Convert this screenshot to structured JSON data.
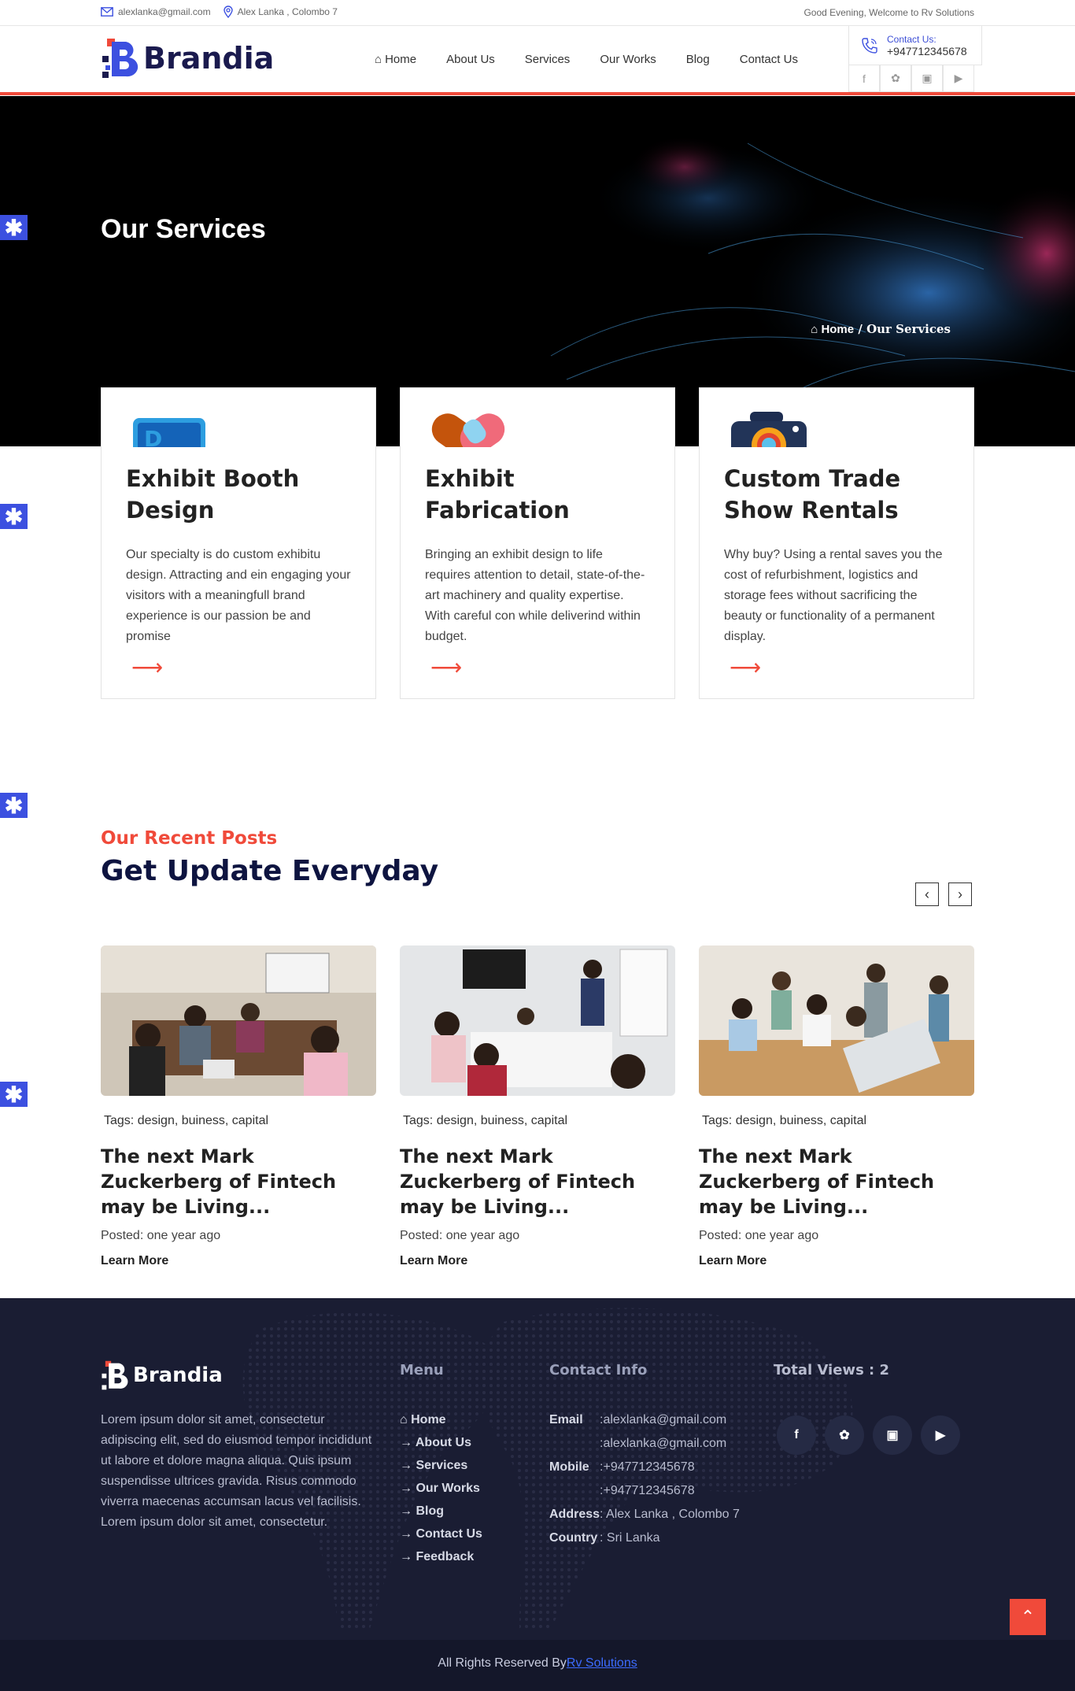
{
  "topbar": {
    "email": "alexlanka@gmail.com",
    "address": "Alex Lanka , Colombo 7",
    "greeting": "Good Evening, Welcome to Rv Solutions"
  },
  "brand": {
    "name": "Brandia"
  },
  "nav": {
    "items": [
      "Home",
      "About Us",
      "Services",
      "Our Works",
      "Blog",
      "Contact Us"
    ]
  },
  "contact_box": {
    "label": "Contact Us:",
    "phone": "+947712345678"
  },
  "hero": {
    "title": "Our Services",
    "breadcrumb_home": "Home",
    "breadcrumb_sep": "/",
    "breadcrumb_current": "Our Services"
  },
  "services": [
    {
      "title": "Exhibit Booth Design",
      "text": "Our specialty is do custom exhibitu design. Attracting and ein engaging your visitors with a meaningfull brand experience is our passion be and promise",
      "icon": "booth-design-icon"
    },
    {
      "title": "Exhibit Fabrication",
      "text": "Bringing an exhibit design to life requires attention to detail, state-of-the-art machinery and quality expertise. With careful con while deliverind within budget.",
      "icon": "fabrication-icon"
    },
    {
      "title": "Custom Trade Show Rentals",
      "text": "Why buy? Using a rental saves you the cost of refurbishment, logistics and storage fees without sacrificing the beauty or functionality of a permanent display.",
      "icon": "camera-rentals-icon"
    }
  ],
  "posts_section": {
    "subtitle": "Our Recent Posts",
    "title": "Get Update Everyday"
  },
  "posts": [
    {
      "tags": "Tags: design, buiness, capital",
      "title": "The next Mark Zuckerberg of Fintech may be Living...",
      "posted": "Posted: one year ago",
      "more": "Learn More"
    },
    {
      "tags": "Tags: design, buiness, capital",
      "title": "The next Mark Zuckerberg of Fintech may be Living...",
      "posted": "Posted: one year ago",
      "more": "Learn More"
    },
    {
      "tags": "Tags: design, buiness, capital",
      "title": "The next Mark Zuckerberg of Fintech may be Living...",
      "posted": "Posted: one year ago",
      "more": "Learn More"
    }
  ],
  "footer": {
    "about": "Lorem ipsum dolor sit amet, consectetur adipiscing elit, sed do eiusmod tempor incididunt ut labore et dolore magna aliqua. Quis ipsum suspendisse ultrices gravida. Risus commodo viverra maecenas accumsan lacus vel facilisis. Lorem ipsum dolor sit amet, consectetur.",
    "menu_title": "Menu",
    "menu": [
      "Home",
      "About Us",
      "Services",
      "Our Works",
      "Blog",
      "Contact Us",
      "Feedback"
    ],
    "contact_title": "Contact Info",
    "contact": {
      "email_label": "Email",
      "email1": ":alexlanka@gmail.com",
      "email2": ":alexlanka@gmail.com",
      "mobile_label": "Mobile",
      "mobile1": ":+947712345678",
      "mobile2": ":+947712345678",
      "address_label": "Address",
      "address": ": Alex Lanka , Colombo 7",
      "country_label": "Country",
      "country": ": Sri Lanka"
    },
    "views_title": "Total Views : 2",
    "copyright_prefix": "All Rights Reserved By",
    "copyright_link": "Rv Solutions"
  },
  "colors": {
    "accent": "#f04a3a",
    "brand_blue": "#3c50e0",
    "navy": "#0e1440",
    "footer_bg": "#1a1d33"
  }
}
